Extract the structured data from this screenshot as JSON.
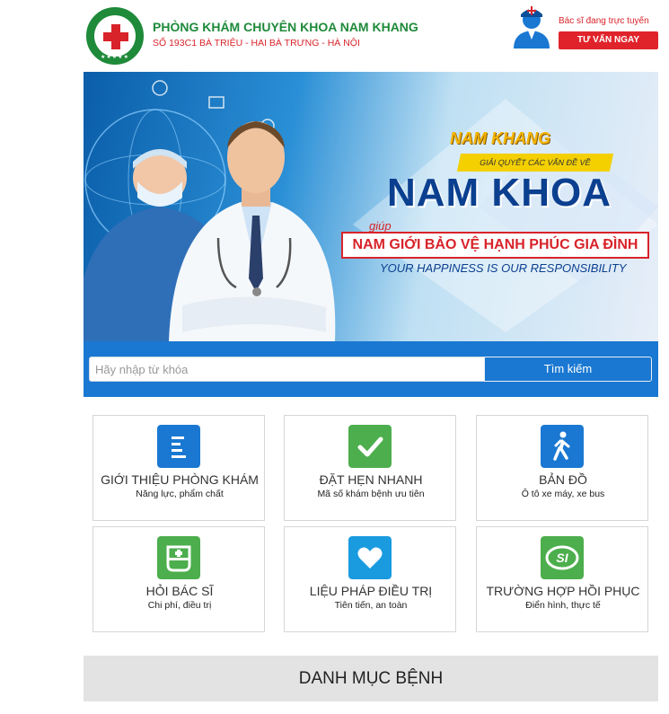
{
  "header": {
    "clinic_name": "PHÒNG KHÁM CHUYÊN KHOA NAM KHANG",
    "address": "SỐ 193C1 BÀ TRIỆU - HAI BÀ TRƯNG - HÀ NỘI",
    "online_text": "Bác sĩ đang trực tuyến",
    "consult_label": "TƯ VẤN NGAY",
    "logo_stars": "★★★★★"
  },
  "banner": {
    "brand": "NAM KHANG",
    "subtitle": "GIẢI QUYẾT CÁC VẤN ĐỀ VỀ",
    "main": "NAM KHOA",
    "giup": "giúp",
    "slogan": "NAM GIỚI BẢO VỆ HẠNH PHÚC GIA ĐÌNH",
    "english": "YOUR HAPPINESS IS OUR RESPONSIBILITY"
  },
  "search": {
    "placeholder": "Hãy nhập từ khóa",
    "button_label": "Tìm kiếm"
  },
  "tiles": [
    {
      "title": "GIỚI THIỆU PHÒNG KHÁM",
      "desc": "Năng lực, phẩm chất",
      "icon": "list-icon",
      "color": "#1a78d2"
    },
    {
      "title": "ĐẶT HẸN NHANH",
      "desc": "Mã số khám bệnh ưu tiên",
      "icon": "check-icon",
      "color": "#4cae4c"
    },
    {
      "title": "BẢN ĐỒ",
      "desc": "Ô tô xe máy, xe bus",
      "icon": "walking-person-icon",
      "color": "#1a78d2"
    },
    {
      "title": "HỎI BÁC SĨ",
      "desc": "Chi phí, điều trị",
      "icon": "medical-kit-icon",
      "color": "#4cae4c"
    },
    {
      "title": "LIỆU PHÁP ĐIỀU TRỊ",
      "desc": "Tiên tiến, an toàn",
      "icon": "heart-icon",
      "color": "#1a9be0"
    },
    {
      "title": "TRƯỜNG HỢP HỒI PHỤC",
      "desc": "Điển hình, thực tế",
      "icon": "si-logo-icon",
      "color": "#4cae4c"
    }
  ],
  "section": {
    "danh_muc": "DANH MỤC BỆNH"
  }
}
